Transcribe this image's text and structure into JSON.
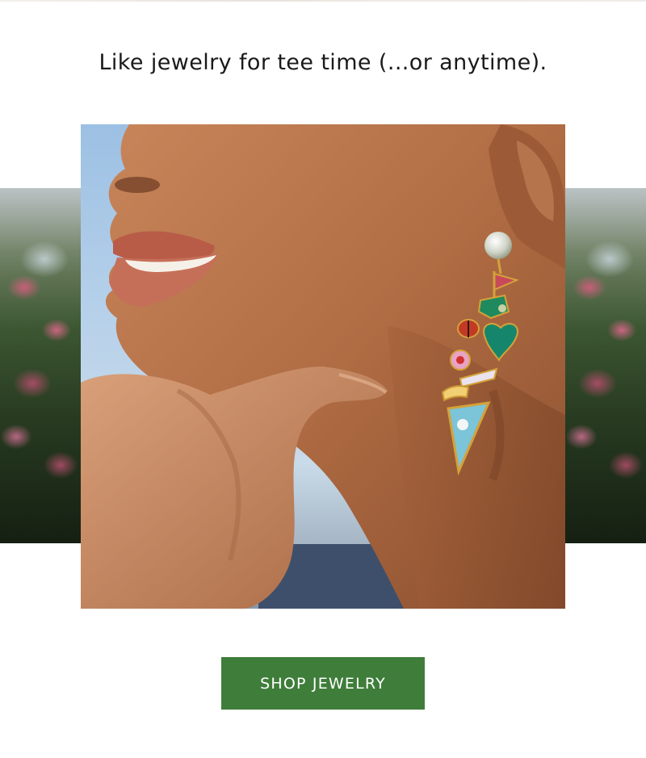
{
  "headline": "Like jewelry for tee time (...or anytime).",
  "hero_image": {
    "icon": "earring-photo",
    "alt_subject": "model-wearing-golf-charm-earring"
  },
  "side_images": {
    "left_icon": "flowers-photo",
    "right_icon": "flowers-photo"
  },
  "cta": {
    "label": "SHOP JEWELRY",
    "background": "#3f7d3a",
    "text_color": "#ffffff"
  }
}
